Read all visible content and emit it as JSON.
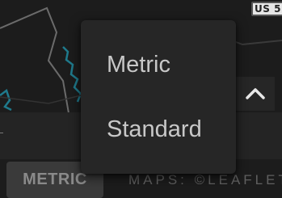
{
  "map": {
    "route_shield_label": "US 5",
    "attribution": "MAPS: ©LEAFLET"
  },
  "units_menu": {
    "options": [
      {
        "label": "Metric"
      },
      {
        "label": "Standard"
      }
    ]
  },
  "controls": {
    "units_toggle_label": "METRIC",
    "expand_icon": "chevron-up-icon"
  },
  "colors": {
    "map_background": "#1c1c1c",
    "menu_background": "#262626",
    "menu_text": "#c8c8c8",
    "road_accent": "#1f7a8c"
  }
}
